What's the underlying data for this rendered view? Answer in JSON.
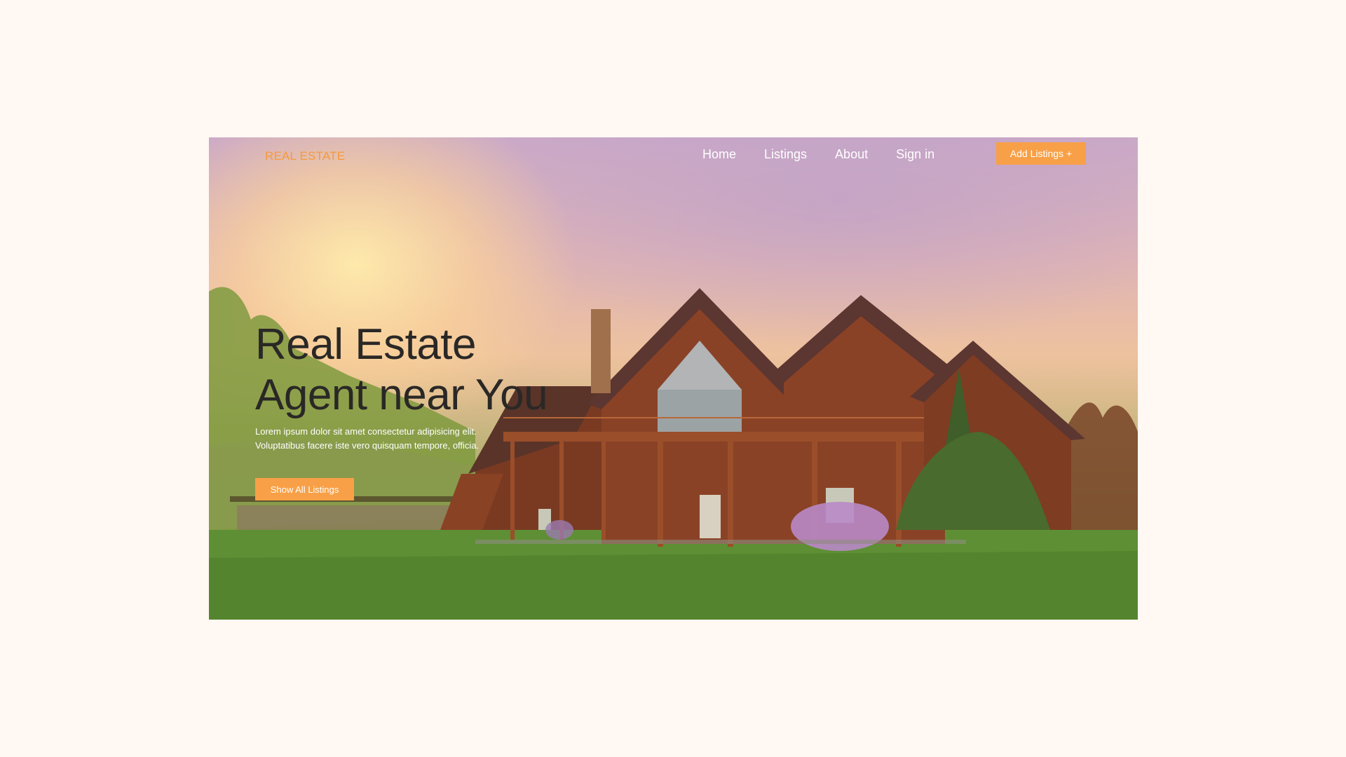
{
  "nav": {
    "logo": "REAL ESTATE",
    "links": [
      "Home",
      "Listings",
      "About",
      "Sign in"
    ],
    "cta_label": "Add Listings",
    "cta_icon": "+"
  },
  "hero": {
    "title_line1": "Real Estate",
    "title_line2": "Agent near You",
    "subtitle_line1": "Lorem ipsum dolor sit amet consectetur adipisicing elit.",
    "subtitle_line2": "Voluptatibus facere iste vero quisquam tempore, officia.",
    "button_label": "Show All Listings"
  },
  "colors": {
    "accent": "#f8a047",
    "logo": "#f59a3c",
    "page_background": "#fff8f3",
    "headline": "#2a2826"
  }
}
